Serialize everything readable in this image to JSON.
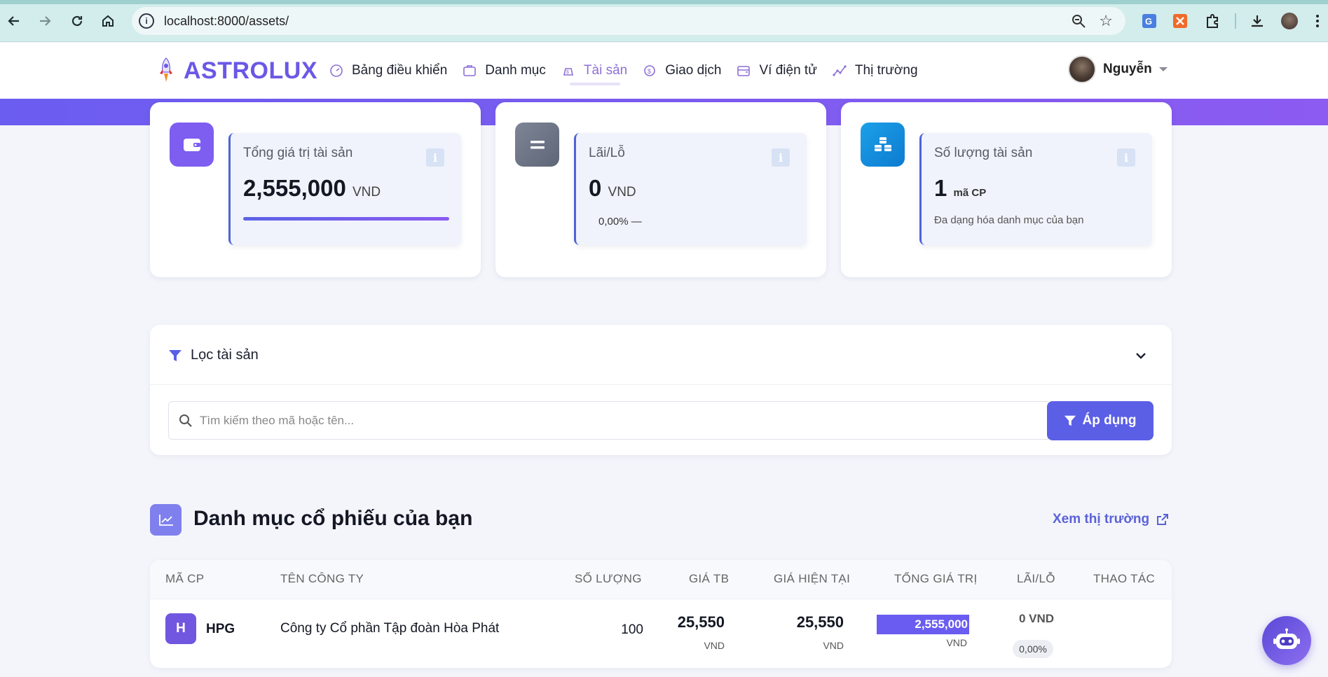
{
  "browser": {
    "url": "localhost:8000/assets/"
  },
  "app": {
    "brand": "ASTROLUX",
    "nav": [
      {
        "label": "Bảng điều khiển",
        "icon": "dashboard-icon"
      },
      {
        "label": "Danh mục",
        "icon": "portfolio-icon"
      },
      {
        "label": "Tài sản",
        "icon": "assets-icon",
        "active": true
      },
      {
        "label": "Giao dịch",
        "icon": "transaction-icon"
      },
      {
        "label": "Ví điện tử",
        "icon": "wallet-icon"
      },
      {
        "label": "Thị trường",
        "icon": "market-icon"
      }
    ],
    "user": {
      "name": "Nguyễn"
    }
  },
  "stats": {
    "total": {
      "label": "Tổng giá trị tài sản",
      "value": "2,555,000",
      "unit": "VND",
      "icon": "wallet-icon",
      "progress_fraction": 1.0
    },
    "pnl": {
      "label": "Lãi/Lỗ",
      "value": "0",
      "unit": "VND",
      "change": "0,00% —",
      "icon": "equals-icon"
    },
    "count": {
      "label": "Số lượng tài sản",
      "value": "1",
      "unit": "mã CP",
      "desc": "Đa dạng hóa danh mục của bạn",
      "icon": "cubes-icon"
    }
  },
  "filter": {
    "title": "Lọc tài sản",
    "search_placeholder": "Tìm kiếm theo mã hoặc tên...",
    "apply_label": "Áp dụng"
  },
  "section": {
    "title": "Danh mục cổ phiếu của bạn",
    "market_link": "Xem thị trường"
  },
  "table": {
    "headers": [
      "MÃ CP",
      "TÊN CÔNG TY",
      "SỐ LƯỢNG",
      "GIÁ TB",
      "GIÁ HIỆN TẠI",
      "TỔNG GIÁ TRỊ",
      "LÃI/LỖ",
      "THAO TÁC"
    ],
    "rows": [
      {
        "badge": "H",
        "symbol": "HPG",
        "company": "Công ty Cổ phần Tập đoàn Hòa Phát",
        "quantity": "100",
        "avg_price": "25,550",
        "avg_unit": "VND",
        "current_price": "25,550",
        "current_unit": "VND",
        "total": "2,555,000",
        "total_unit": "VND",
        "pnl": "0 VND",
        "pnl_pct": "0,00%"
      }
    ]
  },
  "colors": {
    "accent": "#6a58e6",
    "band": "#7a5cf0",
    "card_border": "#4d63d8"
  }
}
